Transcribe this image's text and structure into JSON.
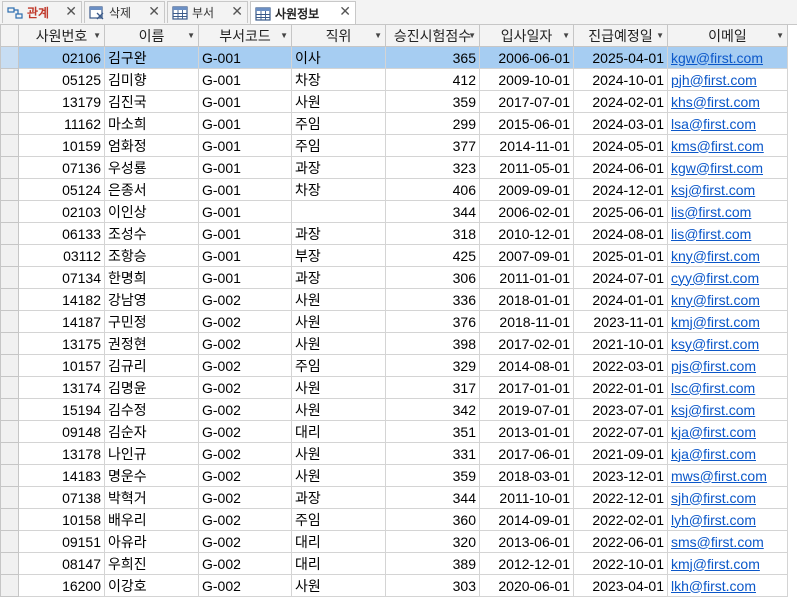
{
  "tabs": [
    {
      "label": "관계",
      "icon": "relationships-icon",
      "active": false
    },
    {
      "label": "삭제",
      "icon": "delete-query-icon",
      "active": false
    },
    {
      "label": "부서",
      "icon": "table-icon",
      "active": false
    },
    {
      "label": "사원정보",
      "icon": "table-icon",
      "active": true
    }
  ],
  "columns": [
    "사원번호",
    "이름",
    "부서코드",
    "직위",
    "승진시험점수",
    "입사일자",
    "진급예정일",
    "이메일"
  ],
  "rows": [
    {
      "id": "02106",
      "name": "김구완",
      "dept": "G-001",
      "pos": "이사",
      "score": "365",
      "hire": "2006-06-01",
      "promo": "2025-04-01",
      "email": "kgw@first.com"
    },
    {
      "id": "05125",
      "name": "김미향",
      "dept": "G-001",
      "pos": "차장",
      "score": "412",
      "hire": "2009-10-01",
      "promo": "2024-10-01",
      "email": "pjh@first.com"
    },
    {
      "id": "13179",
      "name": "김진국",
      "dept": "G-001",
      "pos": "사원",
      "score": "359",
      "hire": "2017-07-01",
      "promo": "2024-02-01",
      "email": "khs@first.com"
    },
    {
      "id": "11162",
      "name": "마소희",
      "dept": "G-001",
      "pos": "주임",
      "score": "299",
      "hire": "2015-06-01",
      "promo": "2024-03-01",
      "email": "lsa@first.com"
    },
    {
      "id": "10159",
      "name": "엄화정",
      "dept": "G-001",
      "pos": "주임",
      "score": "377",
      "hire": "2014-11-01",
      "promo": "2024-05-01",
      "email": "kms@first.com"
    },
    {
      "id": "07136",
      "name": "우성룡",
      "dept": "G-001",
      "pos": "과장",
      "score": "323",
      "hire": "2011-05-01",
      "promo": "2024-06-01",
      "email": "kgw@first.com"
    },
    {
      "id": "05124",
      "name": "은종서",
      "dept": "G-001",
      "pos": "차장",
      "score": "406",
      "hire": "2009-09-01",
      "promo": "2024-12-01",
      "email": "ksj@first.com"
    },
    {
      "id": "02103",
      "name": "이인상",
      "dept": "G-001",
      "pos": "",
      "score": "344",
      "hire": "2006-02-01",
      "promo": "2025-06-01",
      "email": "lis@first.com"
    },
    {
      "id": "06133",
      "name": "조성수",
      "dept": "G-001",
      "pos": "과장",
      "score": "318",
      "hire": "2010-12-01",
      "promo": "2024-08-01",
      "email": "lis@first.com"
    },
    {
      "id": "03112",
      "name": "조항승",
      "dept": "G-001",
      "pos": "부장",
      "score": "425",
      "hire": "2007-09-01",
      "promo": "2025-01-01",
      "email": "kny@first.com"
    },
    {
      "id": "07134",
      "name": "한명희",
      "dept": "G-001",
      "pos": "과장",
      "score": "306",
      "hire": "2011-01-01",
      "promo": "2024-07-01",
      "email": "cyy@first.com"
    },
    {
      "id": "14182",
      "name": "강남영",
      "dept": "G-002",
      "pos": "사원",
      "score": "336",
      "hire": "2018-01-01",
      "promo": "2024-01-01",
      "email": "kny@first.com"
    },
    {
      "id": "14187",
      "name": "구민정",
      "dept": "G-002",
      "pos": "사원",
      "score": "376",
      "hire": "2018-11-01",
      "promo": "2023-11-01",
      "email": "kmj@first.com"
    },
    {
      "id": "13175",
      "name": "권정현",
      "dept": "G-002",
      "pos": "사원",
      "score": "398",
      "hire": "2017-02-01",
      "promo": "2021-10-01",
      "email": "ksy@first.com"
    },
    {
      "id": "10157",
      "name": "김규리",
      "dept": "G-002",
      "pos": "주임",
      "score": "329",
      "hire": "2014-08-01",
      "promo": "2022-03-01",
      "email": "pjs@first.com"
    },
    {
      "id": "13174",
      "name": "김명윤",
      "dept": "G-002",
      "pos": "사원",
      "score": "317",
      "hire": "2017-01-01",
      "promo": "2022-01-01",
      "email": "lsc@first.com"
    },
    {
      "id": "15194",
      "name": "김수정",
      "dept": "G-002",
      "pos": "사원",
      "score": "342",
      "hire": "2019-07-01",
      "promo": "2023-07-01",
      "email": "ksj@first.com"
    },
    {
      "id": "09148",
      "name": "김순자",
      "dept": "G-002",
      "pos": "대리",
      "score": "351",
      "hire": "2013-01-01",
      "promo": "2022-07-01",
      "email": "kja@first.com"
    },
    {
      "id": "13178",
      "name": "나인규",
      "dept": "G-002",
      "pos": "사원",
      "score": "331",
      "hire": "2017-06-01",
      "promo": "2021-09-01",
      "email": "kja@first.com"
    },
    {
      "id": "14183",
      "name": "명운수",
      "dept": "G-002",
      "pos": "사원",
      "score": "359",
      "hire": "2018-03-01",
      "promo": "2023-12-01",
      "email": "mws@first.com"
    },
    {
      "id": "07138",
      "name": "박혁거",
      "dept": "G-002",
      "pos": "과장",
      "score": "344",
      "hire": "2011-10-01",
      "promo": "2022-12-01",
      "email": "sjh@first.com"
    },
    {
      "id": "10158",
      "name": "배우리",
      "dept": "G-002",
      "pos": "주임",
      "score": "360",
      "hire": "2014-09-01",
      "promo": "2022-02-01",
      "email": "lyh@first.com"
    },
    {
      "id": "09151",
      "name": "아유라",
      "dept": "G-002",
      "pos": "대리",
      "score": "320",
      "hire": "2013-06-01",
      "promo": "2022-06-01",
      "email": "sms@first.com"
    },
    {
      "id": "08147",
      "name": "우희진",
      "dept": "G-002",
      "pos": "대리",
      "score": "389",
      "hire": "2012-12-01",
      "promo": "2022-10-01",
      "email": "kmj@first.com"
    },
    {
      "id": "16200",
      "name": "이강호",
      "dept": "G-002",
      "pos": "사원",
      "score": "303",
      "hire": "2020-06-01",
      "promo": "2023-04-01",
      "email": "lkh@first.com"
    }
  ],
  "selected_row_index": 0,
  "colors": {
    "selection": "#a6cdf2",
    "link": "#0b57c9",
    "relationships_tab_text": "#c0392b"
  }
}
